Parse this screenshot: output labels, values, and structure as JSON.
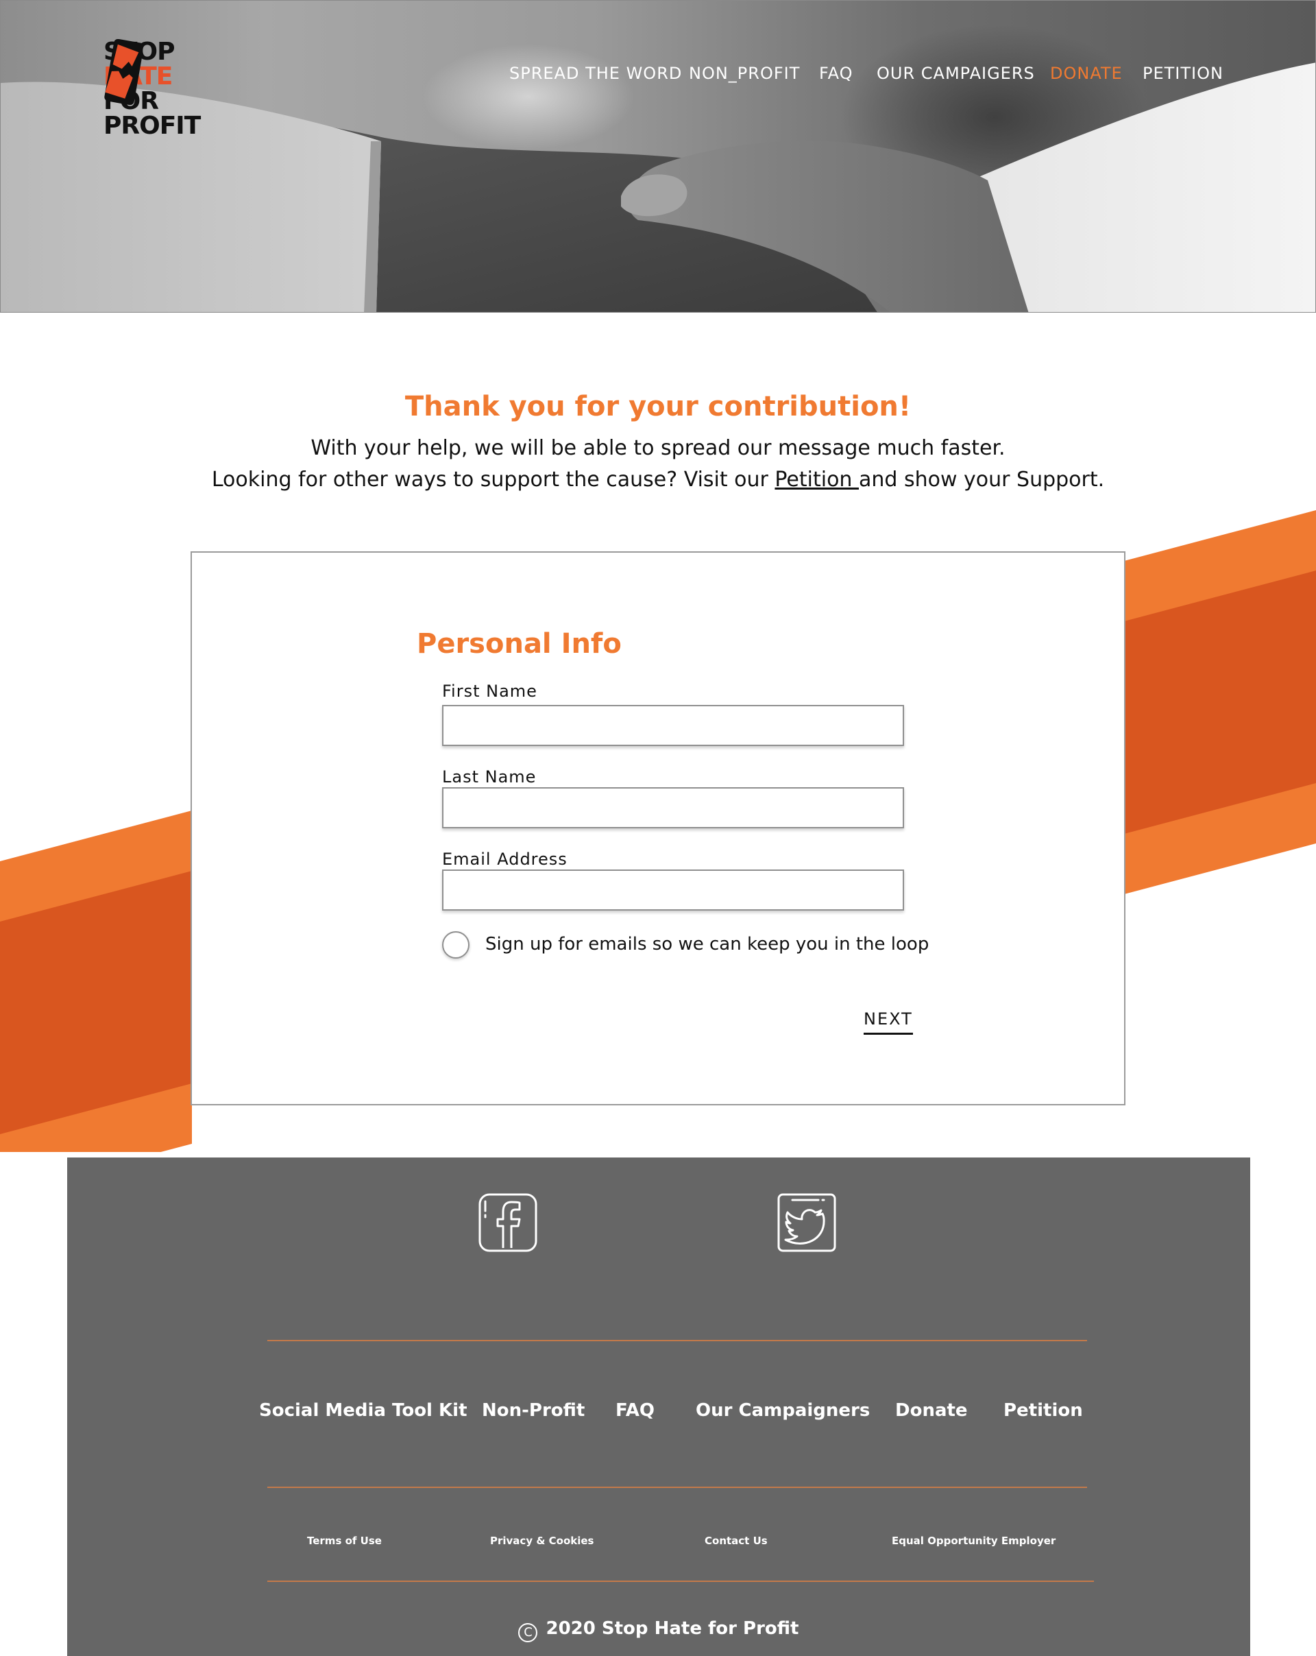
{
  "logo": {
    "line1": "STOP",
    "line2": "HATE",
    "line3": "FOR",
    "line4": "PROFIT"
  },
  "nav": [
    {
      "label": "SPREAD THE WORD",
      "active": false
    },
    {
      "label": "NON_PROFIT",
      "active": false
    },
    {
      "label": "FAQ",
      "active": false
    },
    {
      "label": "OUR CAMPAIGERS",
      "active": false
    },
    {
      "label": "DONATE",
      "active": true
    },
    {
      "label": "PETITION",
      "active": false
    }
  ],
  "intro": {
    "heading": "Thank you for your contribution!",
    "line1": "With your help, we will be able to spread our message much faster.",
    "line2_before": "Looking for other ways to support the cause? Visit our ",
    "line2_link": "Petition ",
    "line2_after": "and show your Support."
  },
  "form": {
    "title": "Personal Info",
    "first_name_label": "First Name",
    "first_name_value": "",
    "last_name_label": "Last Name",
    "last_name_value": "",
    "email_label": "Email Address",
    "email_value": "",
    "signup_label": "Sign up for emails so we can keep you in the loop",
    "next_label": "NEXT"
  },
  "footer": {
    "social": [
      "facebook-icon",
      "twitter-icon"
    ],
    "links": [
      "Social Media Tool Kit",
      "Non-Profit",
      "FAQ",
      "Our Campaigners",
      "Donate",
      "Petition"
    ],
    "legal": [
      "Terms of Use",
      "Privacy & Cookies",
      "Contact Us",
      "Equal Opportunity Employer"
    ],
    "copyright": "2020 Stop Hate for Profit"
  },
  "colors": {
    "accent": "#f07a31",
    "accent_dark": "#d9561f",
    "footer_bg": "#666666",
    "text": "#111111"
  }
}
